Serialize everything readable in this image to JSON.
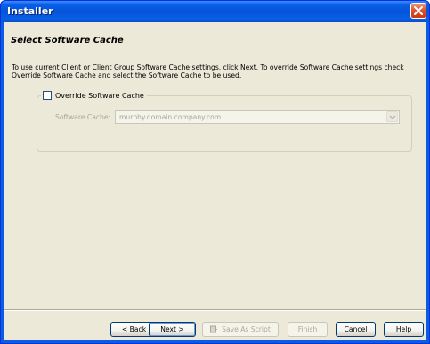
{
  "window": {
    "title": "Installer"
  },
  "page": {
    "title": "Select Software Cache",
    "description": "To use current Client or Client Group Software Cache settings, click Next. To override Software Cache settings check Override Software Cache and select the Software Cache to be used."
  },
  "override": {
    "checkbox_label": "Override Software Cache",
    "checked": false
  },
  "cache": {
    "label": "Software Cache:",
    "value": "murphy.domain.company.com",
    "enabled": false
  },
  "buttons": {
    "back": "< Back",
    "next": "Next >",
    "save_script": "Save As Script",
    "finish": "Finish",
    "cancel": "Cancel",
    "help": "Help"
  },
  "colors": {
    "titlebar": "#0554d6",
    "client_bg": "#ece9d8",
    "close_button": "#e0542c"
  }
}
